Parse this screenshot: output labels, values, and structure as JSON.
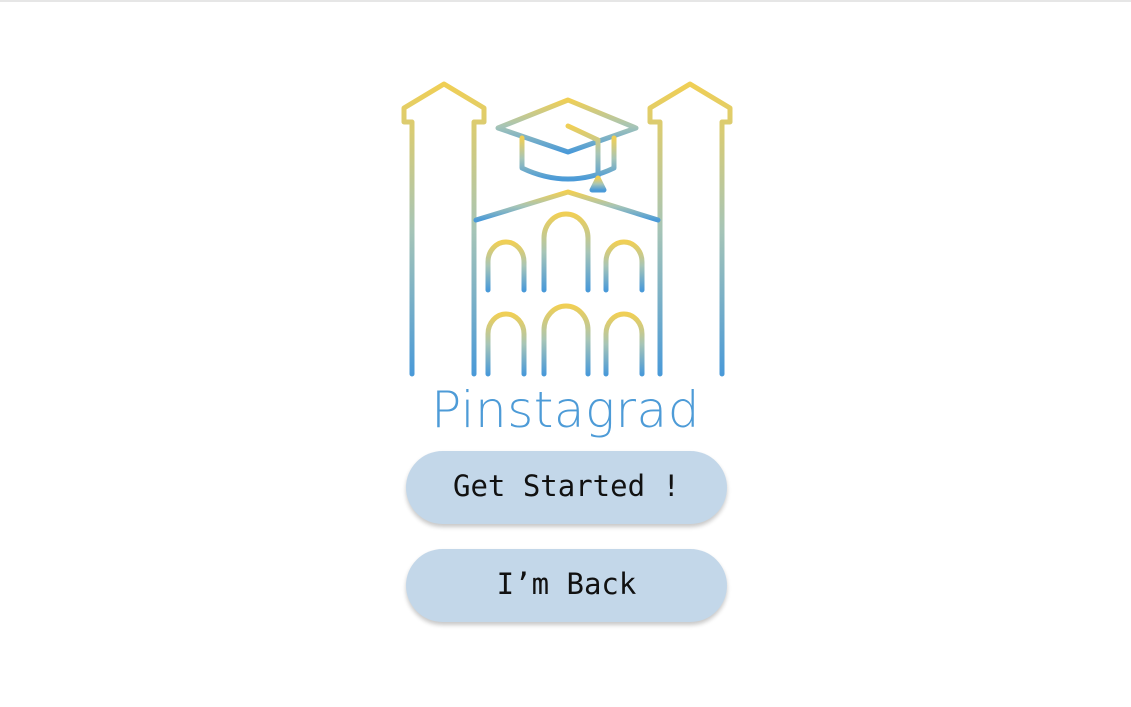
{
  "app": {
    "name": "Pinstagrad",
    "logo_icon": "university-building-graduation-cap-icon"
  },
  "actions": {
    "get_started_label": "Get Started !",
    "im_back_label": "I’m Back"
  },
  "colors": {
    "brand": "#4d9bd7",
    "logo_gradient_top": "#f0cf55",
    "logo_gradient_bottom": "#4a9ad8",
    "button_background": "#c3d7e9",
    "page_background": "#ffffff"
  }
}
